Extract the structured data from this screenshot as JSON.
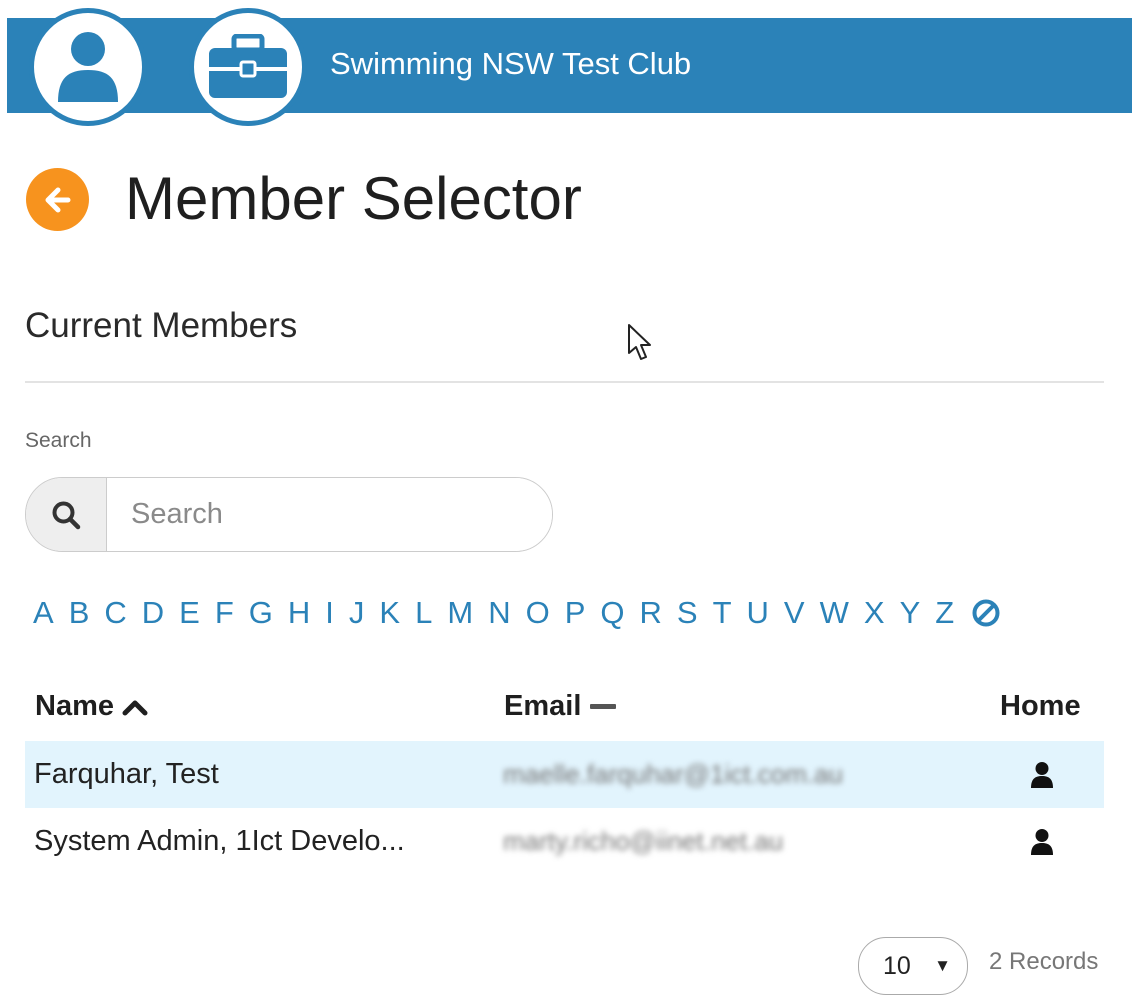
{
  "header": {
    "club_name": "Swimming NSW Test Club",
    "user_icon": "user-icon",
    "club_icon": "briefcase-icon",
    "bar_color": "#2b82b8"
  },
  "page": {
    "title": "Member Selector",
    "back_icon": "arrow-left-icon",
    "back_color": "#f7931e"
  },
  "section": {
    "title": "Current Members"
  },
  "search": {
    "label": "Search",
    "placeholder": "Search",
    "value": "",
    "icon": "search-icon"
  },
  "alphabet": [
    "A",
    "B",
    "C",
    "D",
    "E",
    "F",
    "G",
    "H",
    "I",
    "J",
    "K",
    "L",
    "M",
    "N",
    "O",
    "P",
    "Q",
    "R",
    "S",
    "T",
    "U",
    "V",
    "W",
    "X",
    "Y",
    "Z"
  ],
  "alphabet_clear_icon": "clear-filter-icon",
  "table": {
    "columns": {
      "name": "Name",
      "email": "Email",
      "home": "Home"
    },
    "sort": {
      "name": "ascending",
      "email": "unsorted"
    },
    "rows": [
      {
        "name": "Farquhar, Test",
        "email": "maelle.farquhar@1ict.com.au",
        "home_icon": "user-icon",
        "highlighted": true
      },
      {
        "name": "System Admin, 1Ict Develo...",
        "email": "marty.richo@iinet.net.au",
        "home_icon": "user-icon",
        "highlighted": false
      }
    ]
  },
  "pagination": {
    "page_size": "10",
    "records": "2 Records"
  }
}
